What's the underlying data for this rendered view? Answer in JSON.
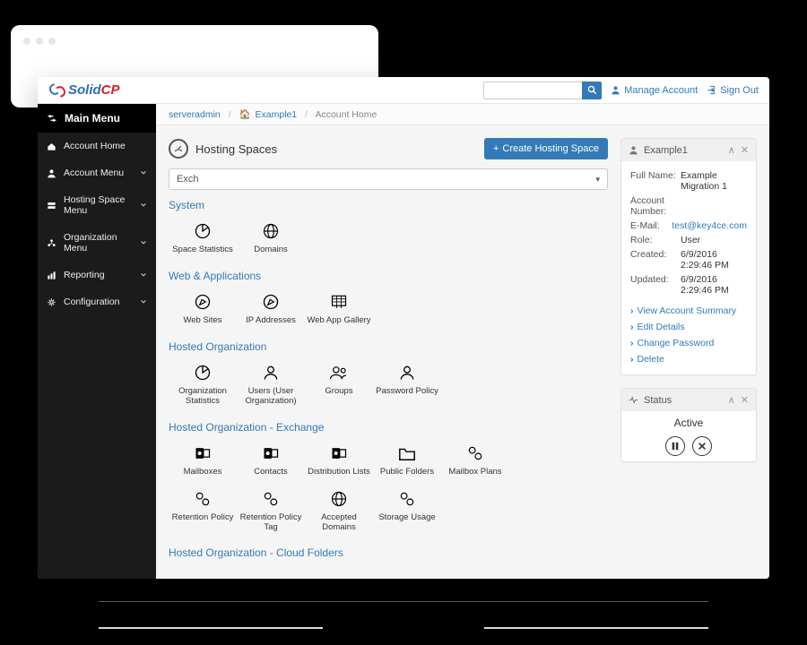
{
  "brand": {
    "solid": "Solid",
    "cp": "CP"
  },
  "topbar": {
    "search_placeholder": "",
    "manage_account": "Manage Account",
    "sign_out": "Sign Out"
  },
  "sidebar": {
    "title": "Main Menu",
    "items": [
      {
        "label": "Account Home"
      },
      {
        "label": "Account Menu"
      },
      {
        "label": "Hosting Space Menu"
      },
      {
        "label": "Organization Menu"
      },
      {
        "label": "Reporting"
      },
      {
        "label": "Configuration"
      }
    ]
  },
  "crumbs": {
    "a": "serveradmin",
    "b": "Example1",
    "c": "Account Home"
  },
  "hosting": {
    "title": "Hosting Spaces",
    "create_btn": "Create Hosting Space",
    "combo": "Exch"
  },
  "sections": {
    "system": {
      "title": "System",
      "tiles": [
        "Space Statistics",
        "Domains"
      ]
    },
    "web": {
      "title": "Web & Applications",
      "tiles": [
        "Web Sites",
        "IP Addresses",
        "Web App Gallery"
      ]
    },
    "org": {
      "title": "Hosted Organization",
      "tiles": [
        "Organization Statistics",
        "Users (User Organization)",
        "Groups",
        "Password Policy"
      ]
    },
    "exch": {
      "title": "Hosted Organization - Exchange",
      "tiles_a": [
        "Mailboxes",
        "Contacts",
        "Distribution Lists",
        "Public Folders",
        "Mailbox Plans"
      ],
      "tiles_b": [
        "Retention Policy",
        "Retention Policy Tag",
        "Accepted Domains",
        "Storage Usage"
      ]
    },
    "cloud": {
      "title": "Hosted Organization - Cloud Folders"
    }
  },
  "account_panel": {
    "title": "Example1",
    "rows": {
      "full_name_k": "Full Name:",
      "full_name_v": "Example Migration 1",
      "acct_k": "Account Number:",
      "acct_v": "",
      "email_k": "E-Mail:",
      "email_v": "test@key4ce.com",
      "role_k": "Role:",
      "role_v": "User",
      "created_k": "Created:",
      "created_v": "6/9/2016 2:29:46 PM",
      "updated_k": "Updated:",
      "updated_v": "6/9/2016 2:29:46 PM"
    },
    "actions": [
      "View Account Summary",
      "Edit Details",
      "Change Password",
      "Delete"
    ]
  },
  "status_panel": {
    "title": "Status",
    "value": "Active"
  }
}
